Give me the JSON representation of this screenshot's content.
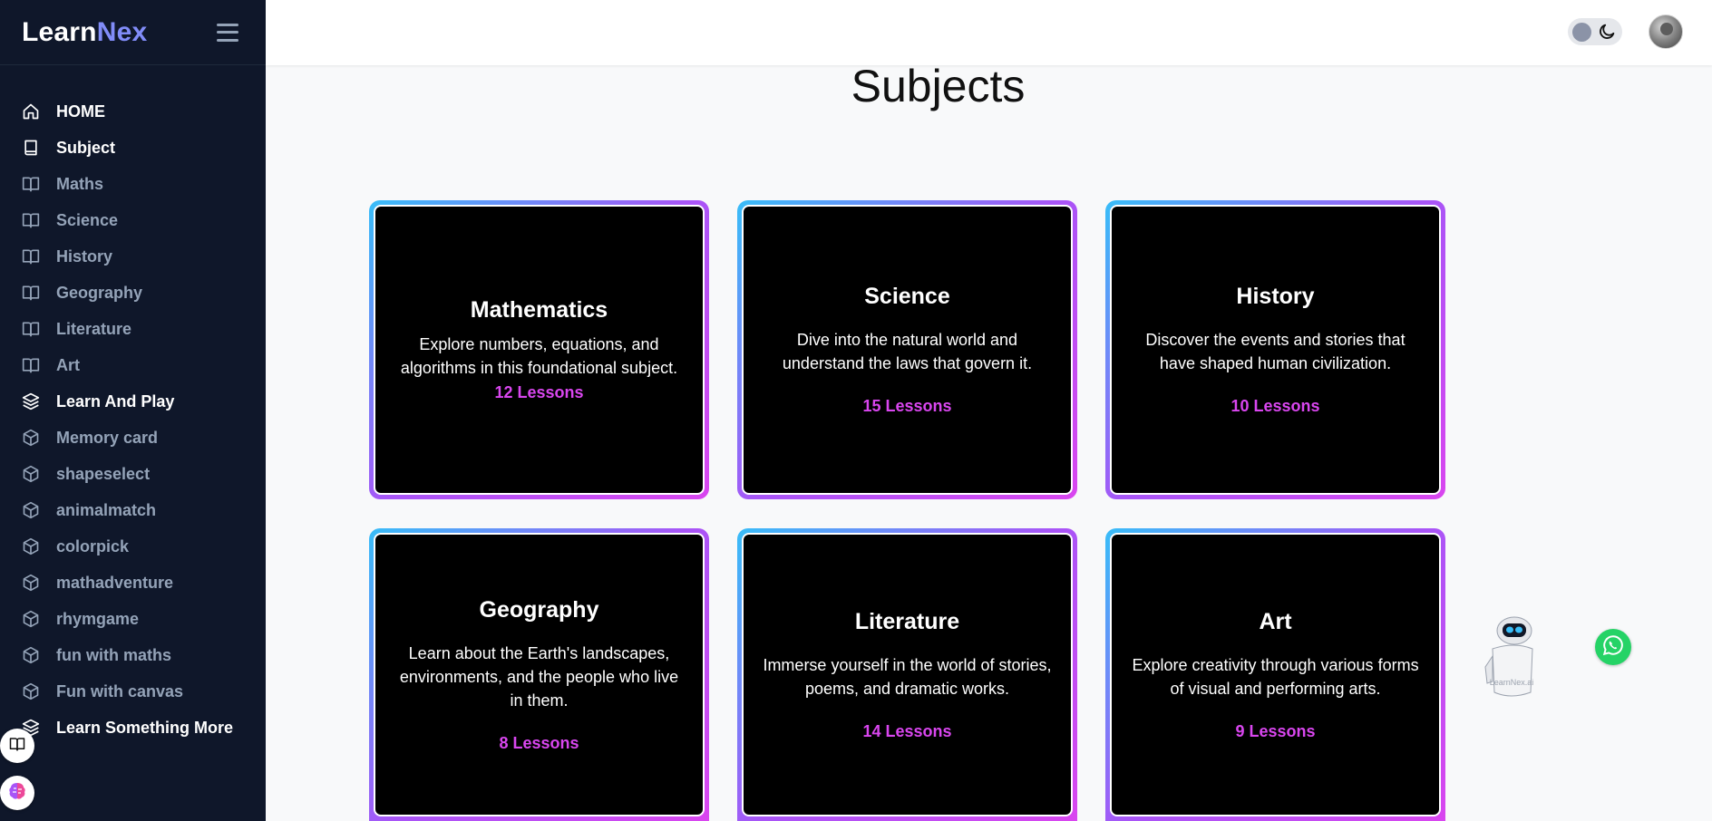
{
  "brand": {
    "part1": "Learn",
    "part2": "Nex"
  },
  "sidebar": {
    "items": [
      {
        "label": "HOME",
        "icon": "home-icon"
      },
      {
        "label": "Subject",
        "icon": "book-icon"
      },
      {
        "label": "Maths",
        "icon": "book-open-icon"
      },
      {
        "label": "Science",
        "icon": "book-open-icon"
      },
      {
        "label": "History",
        "icon": "book-open-icon"
      },
      {
        "label": "Geography",
        "icon": "book-open-icon"
      },
      {
        "label": "Literature",
        "icon": "book-open-icon"
      },
      {
        "label": "Art",
        "icon": "book-open-icon"
      },
      {
        "label": "Learn And Play",
        "icon": "layers-icon"
      },
      {
        "label": "Memory card",
        "icon": "cube-icon"
      },
      {
        "label": "shapeselect",
        "icon": "cube-icon"
      },
      {
        "label": "animalmatch",
        "icon": "cube-icon"
      },
      {
        "label": "colorpick",
        "icon": "cube-icon"
      },
      {
        "label": "mathadventure",
        "icon": "cube-icon"
      },
      {
        "label": "rhymgame",
        "icon": "cube-icon"
      },
      {
        "label": "fun with maths",
        "icon": "cube-icon"
      },
      {
        "label": "Fun with canvas",
        "icon": "cube-icon"
      },
      {
        "label": "Learn Something More",
        "icon": "layers-icon"
      }
    ]
  },
  "main": {
    "title": "Subjects",
    "cards": [
      {
        "title": "Mathematics",
        "description": "Explore numbers, equations, and algorithms in this foundational subject.",
        "lessons": "12 Lessons"
      },
      {
        "title": "Science",
        "description": "Dive into the natural world and understand the laws that govern it.",
        "lessons": "15 Lessons"
      },
      {
        "title": "History",
        "description": "Discover the events and stories that have shaped human civilization.",
        "lessons": "10 Lessons"
      },
      {
        "title": "Geography",
        "description": "Learn about the Earth's landscapes, environments, and the people who live in them.",
        "lessons": "8 Lessons"
      },
      {
        "title": "Literature",
        "description": "Immerse yourself in the world of stories, poems, and dramatic works.",
        "lessons": "14 Lessons"
      },
      {
        "title": "Art",
        "description": "Explore creativity through various forms of visual and performing arts.",
        "lessons": "9 Lessons"
      }
    ]
  },
  "widgets": {
    "robot_label": "LearnNex.ai"
  },
  "colors": {
    "sidebar_bg": "#0f172a",
    "accent": "#818cf8",
    "lesson_color": "#d946ef",
    "card_bg": "#000000"
  }
}
